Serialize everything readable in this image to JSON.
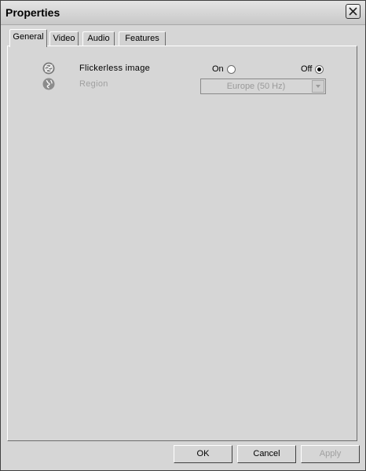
{
  "window": {
    "title": "Properties"
  },
  "tabs": [
    {
      "label": "General",
      "active": true
    },
    {
      "label": "Video",
      "active": false
    },
    {
      "label": "Audio",
      "active": false
    },
    {
      "label": "Features",
      "active": false
    }
  ],
  "general": {
    "flickerless": {
      "label": "Flickerless image",
      "icon": "flickerless-icon",
      "options": [
        {
          "label": "On",
          "checked": false
        },
        {
          "label": "Off",
          "checked": true
        }
      ]
    },
    "region": {
      "label": "Region",
      "icon": "region-icon",
      "enabled": false,
      "selected": "Europe (50 Hz)"
    }
  },
  "buttons": {
    "ok": "OK",
    "cancel": "Cancel",
    "apply": "Apply",
    "apply_enabled": false
  }
}
